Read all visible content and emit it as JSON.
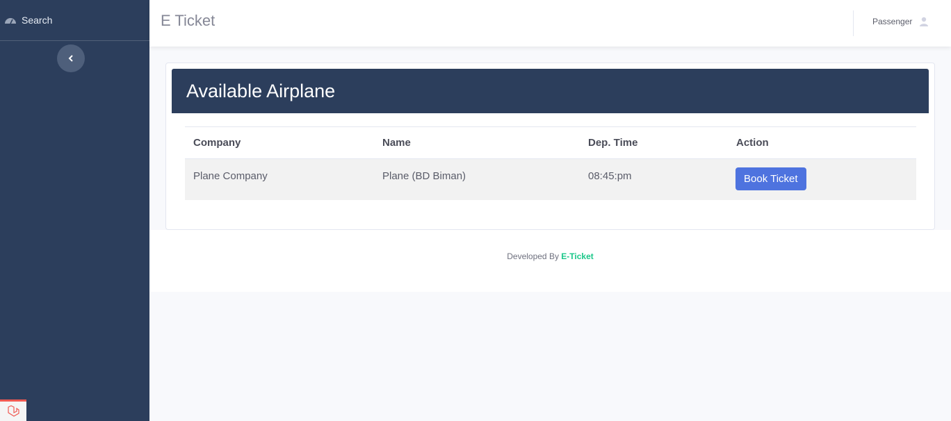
{
  "sidebar": {
    "item_label": "Search"
  },
  "topbar": {
    "brand": "E Ticket",
    "user_label": "Passenger"
  },
  "card": {
    "title": "Available Airplane"
  },
  "table": {
    "headers": [
      "Company",
      "Name",
      "Dep. Time",
      "Action"
    ],
    "rows": [
      {
        "company": "Plane Company",
        "name": "Plane (BD Biman)",
        "dep_time": "08:45:pm",
        "action_label": "Book Ticket"
      }
    ]
  },
  "footer": {
    "prefix": "Developed By",
    "brand": "E-Ticket"
  },
  "colors": {
    "sidebar": "#2c3e5c",
    "button": "#4e73df",
    "footer_brand": "#1cc88a"
  }
}
